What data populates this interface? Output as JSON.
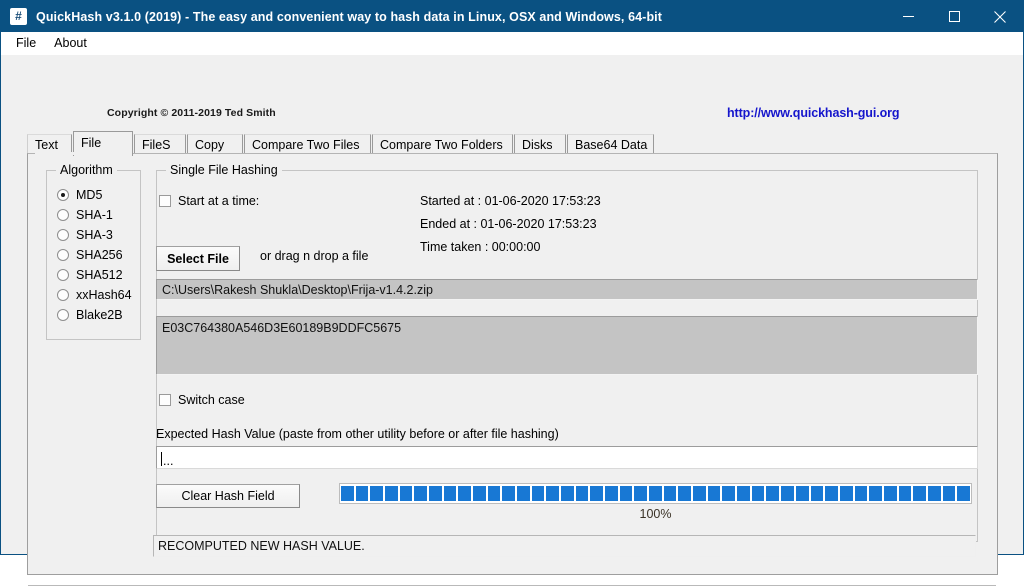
{
  "window": {
    "title": "QuickHash v3.1.0 (2019) - The easy and convenient way to hash data in Linux, OSX and Windows, 64-bit",
    "icon": "hash-icon",
    "titlebar_color": "#0a5182",
    "minimize_label": "Minimize",
    "maximize_label": "Maximize",
    "close_label": "Close"
  },
  "menubar": {
    "items": [
      {
        "label": "File"
      },
      {
        "label": "About"
      }
    ]
  },
  "header": {
    "copyright": "Copyright © 2011-2019  Ted Smith",
    "website": "http://www.quickhash-gui.org",
    "website_color": "#1515cc"
  },
  "tabs": {
    "active": "File",
    "items": [
      {
        "label": "Text"
      },
      {
        "label": "File"
      },
      {
        "label": "FileS"
      },
      {
        "label": "Copy"
      },
      {
        "label": "Compare Two Files"
      },
      {
        "label": "Compare Two Folders"
      },
      {
        "label": "Disks"
      },
      {
        "label": "Base64 Data"
      }
    ]
  },
  "algorithm": {
    "legend": "Algorithm",
    "selected": "MD5",
    "options": [
      {
        "label": "MD5",
        "checked": true
      },
      {
        "label": "SHA-1",
        "checked": false
      },
      {
        "label": "SHA-3",
        "checked": false
      },
      {
        "label": "SHA256",
        "checked": false
      },
      {
        "label": "SHA512",
        "checked": false
      },
      {
        "label": "xxHash64",
        "checked": false
      },
      {
        "label": "Blake2B",
        "checked": false
      }
    ]
  },
  "single_file": {
    "legend": "Single File Hashing",
    "start_at_time": {
      "label": "Start at a time:",
      "checked": false
    },
    "started_at": "Started at : 01-06-2020 17:53:23",
    "ended_at": "Ended at : 01-06-2020 17:53:23",
    "time_taken": "Time taken : 00:00:00",
    "select_file_button": "Select File",
    "drag_drop_hint": "or drag n drop a file",
    "file_path": "C:\\Users\\Rakesh Shukla\\Desktop\\Frija-v1.4.2.zip",
    "hash_value": "E03C764380A546D3E60189B9DDFC5675",
    "switch_case": {
      "label": "Switch case",
      "checked": false
    },
    "expected_hash_label": "Expected Hash Value (paste from other utility before or after file hashing)",
    "expected_hash_value": "...",
    "clear_hash_button": "Clear Hash Field",
    "progress": {
      "percent_label": "100%",
      "percent": 100,
      "segments": 43,
      "bar_color": "#1878d4"
    },
    "status_message": "RECOMPUTED NEW HASH VALUE."
  }
}
